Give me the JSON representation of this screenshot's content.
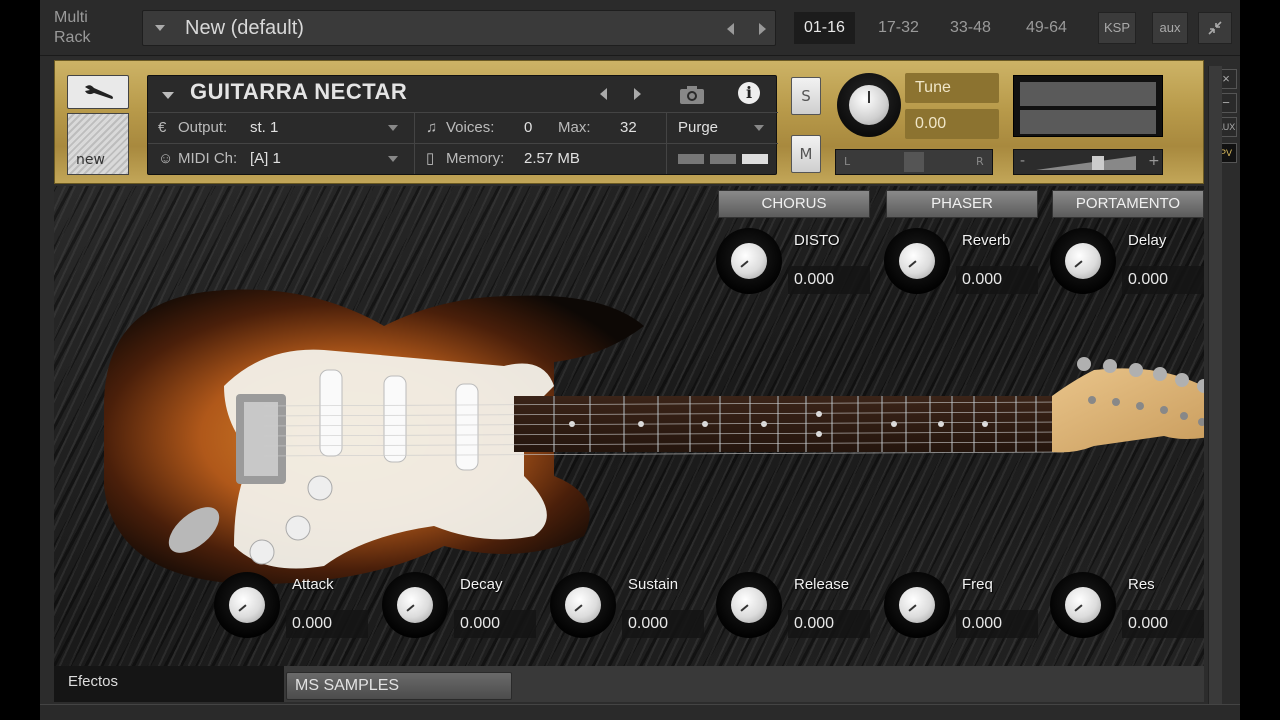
{
  "multirack": {
    "label_line1": "Multi",
    "label_line2": "Rack",
    "rack_name": "New (default)",
    "pages": [
      "01-16",
      "17-32",
      "33-48",
      "49-64"
    ],
    "active_page": "01-16",
    "buttons": {
      "ksp": "KSP",
      "aux": "aux"
    }
  },
  "instrument": {
    "name": "GUITARRA NECTAR",
    "output_label": "Output:",
    "output_value": "st. 1",
    "voices_label": "Voices:",
    "voices_value": "0",
    "max_label": "Max:",
    "max_value": "32",
    "purge_label": "Purge",
    "midi_label": "MIDI Ch:",
    "midi_value": "[A]  1",
    "memory_label": "Memory:",
    "memory_value": "2.57 MB",
    "solo_label": "S",
    "mute_label": "M",
    "tune_label": "Tune",
    "tune_value": "0.00",
    "pan_left": "L",
    "pan_right": "R",
    "vol_minus": "-",
    "vol_plus": "+",
    "side_buttons": {
      "close": "×",
      "minimize": "−",
      "aux": "AUX",
      "pv": "PV"
    },
    "tool_new_label": "new"
  },
  "effects": {
    "buttons": [
      "CHORUS",
      "PHASER",
      "PORTAMENTO"
    ],
    "knobs_top": [
      {
        "label": "DISTO",
        "value": "0.000"
      },
      {
        "label": "Reverb",
        "value": "0.000"
      },
      {
        "label": "Delay",
        "value": "0.000"
      }
    ],
    "knobs_bottom": [
      {
        "label": "Attack",
        "value": "0.000"
      },
      {
        "label": "Decay",
        "value": "0.000"
      },
      {
        "label": "Sustain",
        "value": "0.000"
      },
      {
        "label": "Release",
        "value": "0.000"
      },
      {
        "label": "Freq",
        "value": "0.000"
      },
      {
        "label": "Res",
        "value": "0.000"
      }
    ]
  },
  "footer": {
    "tab_efectos": "Efectos",
    "tab_ms": "MS SAMPLES"
  },
  "colors": {
    "gold": "#b89a4a",
    "panel": "#2a2a2a",
    "guitar_body": "#7a3d10",
    "pickguard": "#f3f1ea"
  }
}
